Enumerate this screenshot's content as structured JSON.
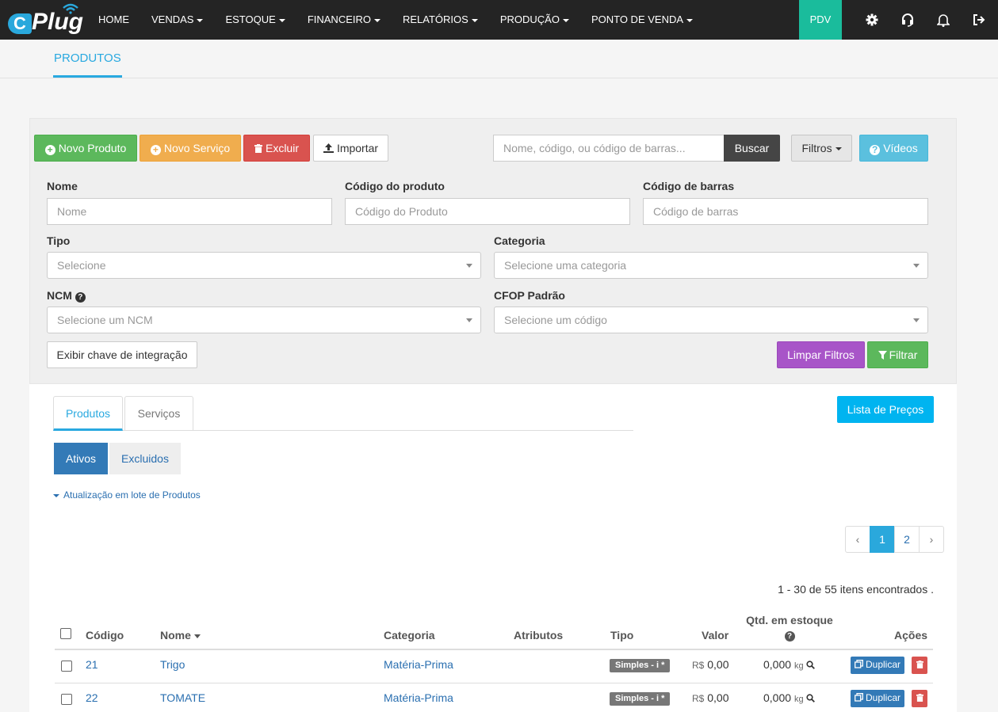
{
  "navbar": {
    "logo_c": "C",
    "logo_text": "Plug",
    "menu": [
      {
        "label": "HOME",
        "caret": false
      },
      {
        "label": "VENDAS",
        "caret": true
      },
      {
        "label": "ESTOQUE",
        "caret": true
      },
      {
        "label": "FINANCEIRO",
        "caret": true
      },
      {
        "label": "RELATÓRIOS",
        "caret": true
      },
      {
        "label": "PRODUÇÃO",
        "caret": true
      },
      {
        "label": "PONTO DE VENDA",
        "caret": true
      }
    ],
    "pdv_label": "PDV",
    "icons": [
      "gear-icon",
      "headset-icon",
      "bell-icon",
      "logout-icon"
    ]
  },
  "subheader": {
    "tab": "PRODUTOS"
  },
  "toolbar": {
    "novo_produto": "Novo Produto",
    "novo_servico": "Novo Serviço",
    "excluir": "Excluir",
    "importar": "Importar",
    "search_placeholder": "Nome, código, ou código de barras...",
    "buscar": "Buscar",
    "filtros": "Filtros",
    "videos": "Vídeos"
  },
  "filters": {
    "nome_label": "Nome",
    "nome_placeholder": "Nome",
    "codigo_label": "Código do produto",
    "codigo_placeholder": "Código do Produto",
    "barras_label": "Código de barras",
    "barras_placeholder": "Código de barras",
    "tipo_label": "Tipo",
    "tipo_value": "Selecione",
    "categoria_label": "Categoria",
    "categoria_value": "Selecione uma categoria",
    "ncm_label": "NCM",
    "ncm_value": "Selecione um NCM",
    "cfop_label": "CFOP Padrão",
    "cfop_value": "Selecione um código",
    "exibir_chave": "Exibir chave de integração",
    "limpar": "Limpar Filtros",
    "filtrar": "Filtrar"
  },
  "main": {
    "tabs": [
      "Produtos",
      "Serviços"
    ],
    "lista_precos": "Lista de Preços",
    "pills": [
      "Ativos",
      "Excluidos"
    ],
    "lote_link": "Atualização em lote de Produtos",
    "pagination": [
      "‹",
      "1",
      "2",
      "›"
    ],
    "count_text": "1 - 30 de 55 itens encontrados ."
  },
  "table": {
    "headers": {
      "codigo": "Código",
      "nome": "Nome",
      "categoria": "Categoria",
      "atributos": "Atributos",
      "tipo": "Tipo",
      "valor": "Valor",
      "qtd": "Qtd. em estoque",
      "acoes": "Ações"
    },
    "rows": [
      {
        "codigo": "21",
        "nome": "Trigo",
        "categoria": "Matéria-Prima",
        "tipo": "Simples - i *",
        "currency": "R$",
        "valor": "0,00",
        "qtd": "0,000",
        "unit": "kg",
        "duplicar": "Duplicar"
      },
      {
        "codigo": "22",
        "nome": "TOMATE",
        "categoria": "Matéria-Prima",
        "tipo": "Simples - i *",
        "currency": "R$",
        "valor": "0,00",
        "qtd": "0,000",
        "unit": "kg",
        "duplicar": "Duplicar"
      }
    ]
  }
}
